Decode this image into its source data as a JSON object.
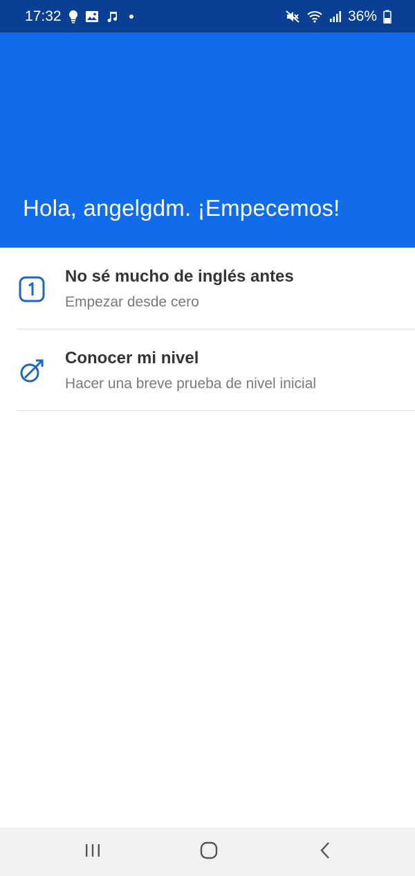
{
  "status_bar": {
    "time": "17:32",
    "battery": "36%",
    "icons": [
      "lightbulb-icon",
      "image-icon",
      "music-note-icon",
      "dot-icon",
      "mute-icon",
      "wifi-icon",
      "signal-icon",
      "battery-icon"
    ]
  },
  "header": {
    "title": "Hola, angelgdm. ¡Empecemos!",
    "background": "#116ceb"
  },
  "options": [
    {
      "title": "No sé mucho de inglés antes",
      "subtitle": "Empezar desde cero",
      "icon": "number-one-icon"
    },
    {
      "title": "Conocer mi nivel",
      "subtitle": "Hacer una breve prueba de nivel inicial",
      "icon": "level-test-icon"
    }
  ],
  "nav_bar": {
    "icons": [
      "recent-apps-icon",
      "home-icon",
      "back-icon"
    ]
  },
  "colors": {
    "status_bar": "#0a3f94",
    "accent": "#116ceb",
    "icon_blue": "#1a66c9",
    "title_text": "#333638",
    "subtitle_text": "#767b80"
  }
}
